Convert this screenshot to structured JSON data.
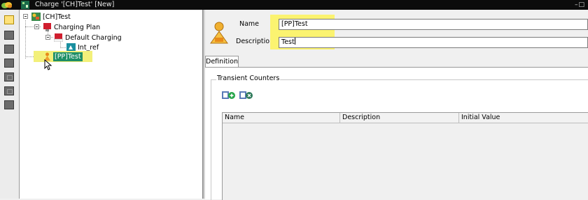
{
  "window": {
    "title": "Charge '[CH]Test' [New]",
    "controls": "–□"
  },
  "tree": {
    "root": {
      "label": "[CH]Test"
    },
    "charging_plan": {
      "label": "Charging Plan"
    },
    "default_charging": {
      "label": "Default Charging"
    },
    "int_ref": {
      "label": "Int_ref"
    },
    "selected": {
      "label": "[PP]Test"
    }
  },
  "form": {
    "name_label": "Name",
    "name_value": "[PP]Test",
    "description_label": "Description",
    "description_value": "Test",
    "tab_definition": "Definition",
    "transient_counters": {
      "title": "Transient Counters",
      "columns": [
        "Name",
        "Description",
        "Initial Value"
      ],
      "rows": []
    }
  },
  "colors": {
    "highlight": "#fbf370",
    "selection": "#1f8f66",
    "titlebar": "#0c0c0c"
  }
}
